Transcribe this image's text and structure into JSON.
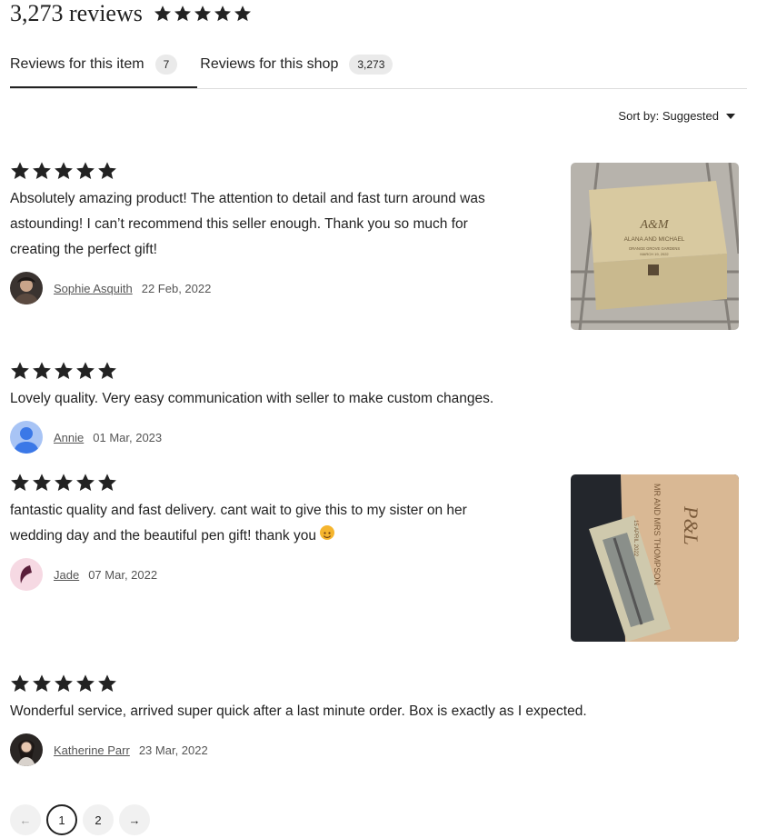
{
  "header": {
    "review_count": "3,273 reviews",
    "rating": 5
  },
  "tabs": [
    {
      "label": "Reviews for this item",
      "count": "7"
    },
    {
      "label": "Reviews for this shop",
      "count": "3,273"
    }
  ],
  "sort": {
    "label": "Sort by: Suggested"
  },
  "reviews": [
    {
      "rating": 5,
      "text": "Absolutely amazing product! The attention to detail and fast turn around was astounding! I can’t recommend this seller enough. Thank you so much for creating the perfect gift!",
      "reviewer": "Sophie Asquith",
      "date": "22 Feb, 2022",
      "photo": {
        "line1": "ALANA AND MICHAEL",
        "line2": "ORANGE GROVE GARDENS",
        "line3": "MARCH 19, 2022"
      }
    },
    {
      "rating": 5,
      "text": "Lovely quality. Very easy communication with seller to make custom changes.",
      "reviewer": "Annie",
      "date": "01 Mar, 2023"
    },
    {
      "rating": 5,
      "text": "fantastic quality and fast delivery. cant wait to give this to my sister on her wedding day and the beautiful pen gift! thank you",
      "reviewer": "Jade",
      "date": "07 Mar, 2022",
      "photo": {
        "line1": "MR AND MRS THOMPSON",
        "line2": "15 APRIL 2022"
      }
    },
    {
      "rating": 5,
      "text": "Wonderful service, arrived super quick after a last minute order. Box is exactly as I expected.",
      "reviewer": "Katherine Parr",
      "date": "23 Mar, 2022"
    }
  ],
  "pagination": {
    "prev": "←",
    "pages": [
      "1",
      "2"
    ],
    "current": "1",
    "next": "→"
  },
  "colors": {
    "text": "#222222",
    "muted": "#555555",
    "pill": "#eaeaea",
    "divider": "#dddddd"
  }
}
